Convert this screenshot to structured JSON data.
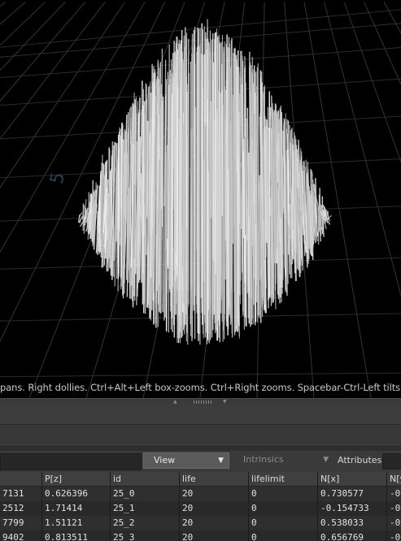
{
  "viewport": {
    "grid_label": "5",
    "hint_text": "pans. Right dollies. Ctrl+Alt+Left box-zooms. Ctrl+Right zooms. Spacebar-Ctrl-Left tilts. Hold L for alte"
  },
  "spreadsheet": {
    "view_select": "View",
    "intrinsics_select": "Intrinsics",
    "attributes_label": "Attributes:",
    "columns": [
      "",
      "P[z]",
      "id",
      "life",
      "lifelimit",
      "N[x]",
      "N[y"
    ],
    "rows": [
      [
        "7131",
        "0.626396",
        "25_0",
        "20",
        "0",
        "0.730577",
        "-0"
      ],
      [
        "2512",
        "1.71414",
        "25_1",
        "20",
        "0",
        "-0.154733",
        "-0"
      ],
      [
        "7799",
        "1.51121",
        "25_2",
        "20",
        "0",
        "0.538033",
        "-0"
      ],
      [
        "9402",
        "0.813511",
        "25_3",
        "20",
        "0",
        "0.656769",
        "-0"
      ]
    ]
  }
}
